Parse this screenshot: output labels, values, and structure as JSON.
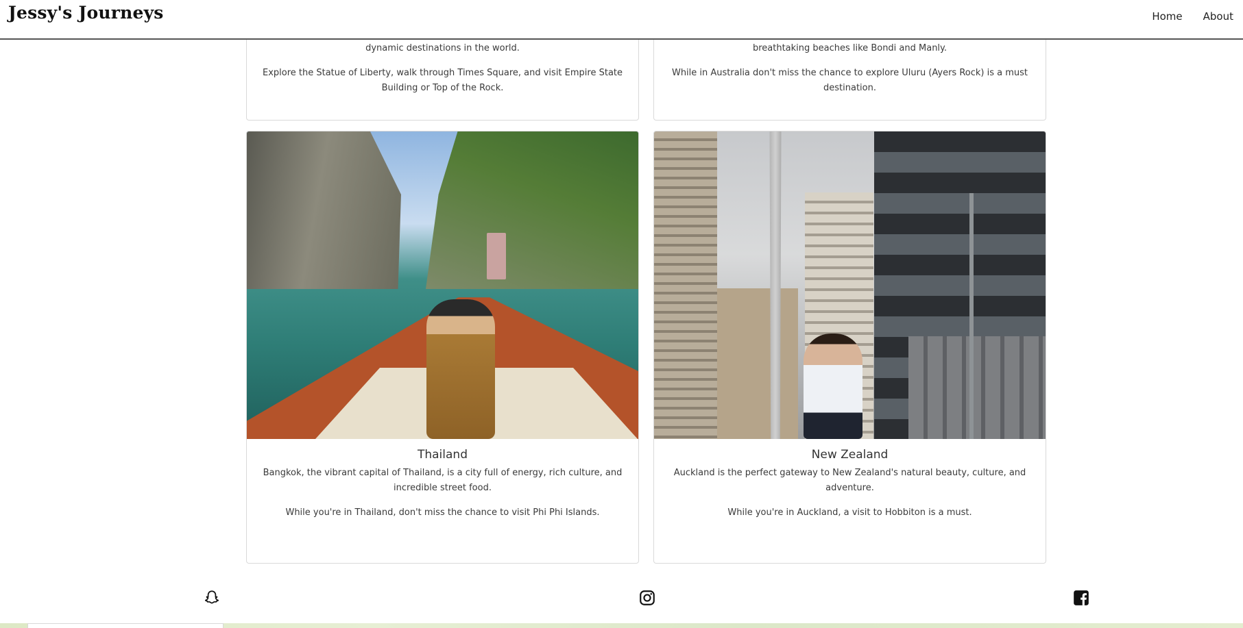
{
  "header": {
    "brand": "Jessy's Journeys",
    "nav": [
      {
        "label": "Home"
      },
      {
        "label": "About"
      }
    ]
  },
  "cards_top": [
    {
      "text1": "dynamic destinations in the world.",
      "text2": "Explore the Statue of Liberty, walk through Times Square, and visit Empire State Building or Top of the Rock."
    },
    {
      "text1": "breathtaking beaches like Bondi and Manly.",
      "text2": "While in Australia don't miss the chance to explore Uluru (Ayers Rock) is a must destination."
    }
  ],
  "cards": [
    {
      "title": "Thailand",
      "text1": "Bangkok, the vibrant capital of Thailand, is a city full of energy, rich culture, and incredible street food.",
      "text2": "While you're in Thailand, don't miss the chance to visit Phi Phi Islands.",
      "image_alt": "Woman sitting on a longtail boat among limestone cliffs"
    },
    {
      "title": "New Zealand",
      "text1": "Auckland is the perfect gateway to New Zealand's natural beauty, culture, and adventure.",
      "text2": "While you're in Auckland, a visit to Hobbiton is a must.",
      "image_alt": "Woman smiling in Auckland city street with Sky Tower"
    }
  ],
  "footer": {
    "icons": [
      "snapchat-icon",
      "instagram-icon",
      "facebook-icon"
    ]
  }
}
